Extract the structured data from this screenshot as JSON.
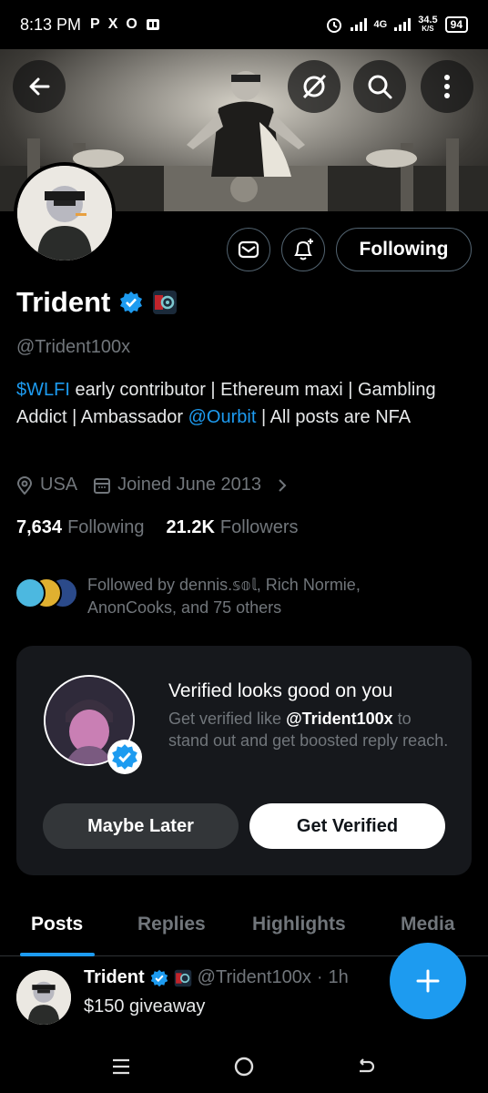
{
  "status_bar": {
    "time": "8:13 PM",
    "app_icons": [
      "P",
      "X",
      "O"
    ],
    "network": "4G",
    "speed_value": "34.5",
    "speed_unit": "K/S",
    "battery": "94"
  },
  "banner": {
    "back_icon": "arrow-left-icon",
    "grok_icon": "grok-icon",
    "search_icon": "search-icon",
    "more_icon": "more-vertical-icon"
  },
  "profile": {
    "name": "Trident",
    "handle": "@Trident100x",
    "bio_parts": {
      "link1": "$WLFI",
      "text1": " early contributor | Ethereum maxi | Gambling Addict | Ambassador ",
      "link2": "@Ourbit",
      "text2": " | All posts are NFA"
    },
    "location": "USA",
    "joined": "Joined June 2013",
    "following_count": "7,634",
    "following_label": "Following",
    "followers_count": "21.2K",
    "followers_label": "Followers",
    "followed_by": "Followed by dennis.𝕤𝕠𝕝, Rich Normie, AnonCooks, and 75 others",
    "follow_button": "Following"
  },
  "verified_card": {
    "title": "Verified looks good on you",
    "subtitle_pre": "Get verified like ",
    "subtitle_handle": "@Trident100x",
    "subtitle_post": " to stand out and get boosted reply reach.",
    "later_label": "Maybe Later",
    "verify_label": "Get Verified"
  },
  "tabs": [
    {
      "label": "Posts",
      "active": true
    },
    {
      "label": "Replies",
      "active": false
    },
    {
      "label": "Highlights",
      "active": false
    },
    {
      "label": "Media",
      "active": false
    }
  ],
  "post": {
    "name": "Trident",
    "handle": "@Trident100x",
    "time": "1h",
    "separator": "·",
    "text": "$150 giveaway"
  },
  "colors": {
    "accent": "#1d9bf0",
    "background": "#000000",
    "muted": "#71767b",
    "card": "#16181c"
  }
}
